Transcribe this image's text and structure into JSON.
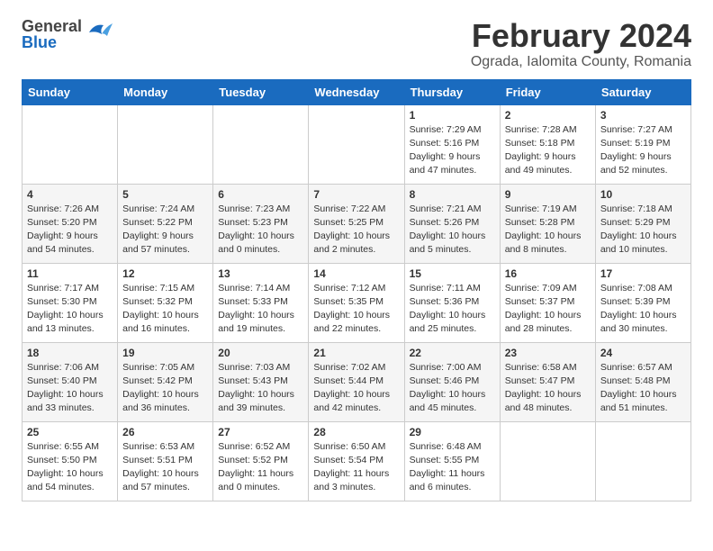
{
  "header": {
    "logo_general": "General",
    "logo_blue": "Blue",
    "title": "February 2024",
    "subtitle": "Ograda, Ialomita County, Romania"
  },
  "weekdays": [
    "Sunday",
    "Monday",
    "Tuesday",
    "Wednesday",
    "Thursday",
    "Friday",
    "Saturday"
  ],
  "weeks": [
    [
      {
        "day": "",
        "content": ""
      },
      {
        "day": "",
        "content": ""
      },
      {
        "day": "",
        "content": ""
      },
      {
        "day": "",
        "content": ""
      },
      {
        "day": "1",
        "content": "Sunrise: 7:29 AM\nSunset: 5:16 PM\nDaylight: 9 hours\nand 47 minutes."
      },
      {
        "day": "2",
        "content": "Sunrise: 7:28 AM\nSunset: 5:18 PM\nDaylight: 9 hours\nand 49 minutes."
      },
      {
        "day": "3",
        "content": "Sunrise: 7:27 AM\nSunset: 5:19 PM\nDaylight: 9 hours\nand 52 minutes."
      }
    ],
    [
      {
        "day": "4",
        "content": "Sunrise: 7:26 AM\nSunset: 5:20 PM\nDaylight: 9 hours\nand 54 minutes."
      },
      {
        "day": "5",
        "content": "Sunrise: 7:24 AM\nSunset: 5:22 PM\nDaylight: 9 hours\nand 57 minutes."
      },
      {
        "day": "6",
        "content": "Sunrise: 7:23 AM\nSunset: 5:23 PM\nDaylight: 10 hours\nand 0 minutes."
      },
      {
        "day": "7",
        "content": "Sunrise: 7:22 AM\nSunset: 5:25 PM\nDaylight: 10 hours\nand 2 minutes."
      },
      {
        "day": "8",
        "content": "Sunrise: 7:21 AM\nSunset: 5:26 PM\nDaylight: 10 hours\nand 5 minutes."
      },
      {
        "day": "9",
        "content": "Sunrise: 7:19 AM\nSunset: 5:28 PM\nDaylight: 10 hours\nand 8 minutes."
      },
      {
        "day": "10",
        "content": "Sunrise: 7:18 AM\nSunset: 5:29 PM\nDaylight: 10 hours\nand 10 minutes."
      }
    ],
    [
      {
        "day": "11",
        "content": "Sunrise: 7:17 AM\nSunset: 5:30 PM\nDaylight: 10 hours\nand 13 minutes."
      },
      {
        "day": "12",
        "content": "Sunrise: 7:15 AM\nSunset: 5:32 PM\nDaylight: 10 hours\nand 16 minutes."
      },
      {
        "day": "13",
        "content": "Sunrise: 7:14 AM\nSunset: 5:33 PM\nDaylight: 10 hours\nand 19 minutes."
      },
      {
        "day": "14",
        "content": "Sunrise: 7:12 AM\nSunset: 5:35 PM\nDaylight: 10 hours\nand 22 minutes."
      },
      {
        "day": "15",
        "content": "Sunrise: 7:11 AM\nSunset: 5:36 PM\nDaylight: 10 hours\nand 25 minutes."
      },
      {
        "day": "16",
        "content": "Sunrise: 7:09 AM\nSunset: 5:37 PM\nDaylight: 10 hours\nand 28 minutes."
      },
      {
        "day": "17",
        "content": "Sunrise: 7:08 AM\nSunset: 5:39 PM\nDaylight: 10 hours\nand 30 minutes."
      }
    ],
    [
      {
        "day": "18",
        "content": "Sunrise: 7:06 AM\nSunset: 5:40 PM\nDaylight: 10 hours\nand 33 minutes."
      },
      {
        "day": "19",
        "content": "Sunrise: 7:05 AM\nSunset: 5:42 PM\nDaylight: 10 hours\nand 36 minutes."
      },
      {
        "day": "20",
        "content": "Sunrise: 7:03 AM\nSunset: 5:43 PM\nDaylight: 10 hours\nand 39 minutes."
      },
      {
        "day": "21",
        "content": "Sunrise: 7:02 AM\nSunset: 5:44 PM\nDaylight: 10 hours\nand 42 minutes."
      },
      {
        "day": "22",
        "content": "Sunrise: 7:00 AM\nSunset: 5:46 PM\nDaylight: 10 hours\nand 45 minutes."
      },
      {
        "day": "23",
        "content": "Sunrise: 6:58 AM\nSunset: 5:47 PM\nDaylight: 10 hours\nand 48 minutes."
      },
      {
        "day": "24",
        "content": "Sunrise: 6:57 AM\nSunset: 5:48 PM\nDaylight: 10 hours\nand 51 minutes."
      }
    ],
    [
      {
        "day": "25",
        "content": "Sunrise: 6:55 AM\nSunset: 5:50 PM\nDaylight: 10 hours\nand 54 minutes."
      },
      {
        "day": "26",
        "content": "Sunrise: 6:53 AM\nSunset: 5:51 PM\nDaylight: 10 hours\nand 57 minutes."
      },
      {
        "day": "27",
        "content": "Sunrise: 6:52 AM\nSunset: 5:52 PM\nDaylight: 11 hours\nand 0 minutes."
      },
      {
        "day": "28",
        "content": "Sunrise: 6:50 AM\nSunset: 5:54 PM\nDaylight: 11 hours\nand 3 minutes."
      },
      {
        "day": "29",
        "content": "Sunrise: 6:48 AM\nSunset: 5:55 PM\nDaylight: 11 hours\nand 6 minutes."
      },
      {
        "day": "",
        "content": ""
      },
      {
        "day": "",
        "content": ""
      }
    ]
  ]
}
